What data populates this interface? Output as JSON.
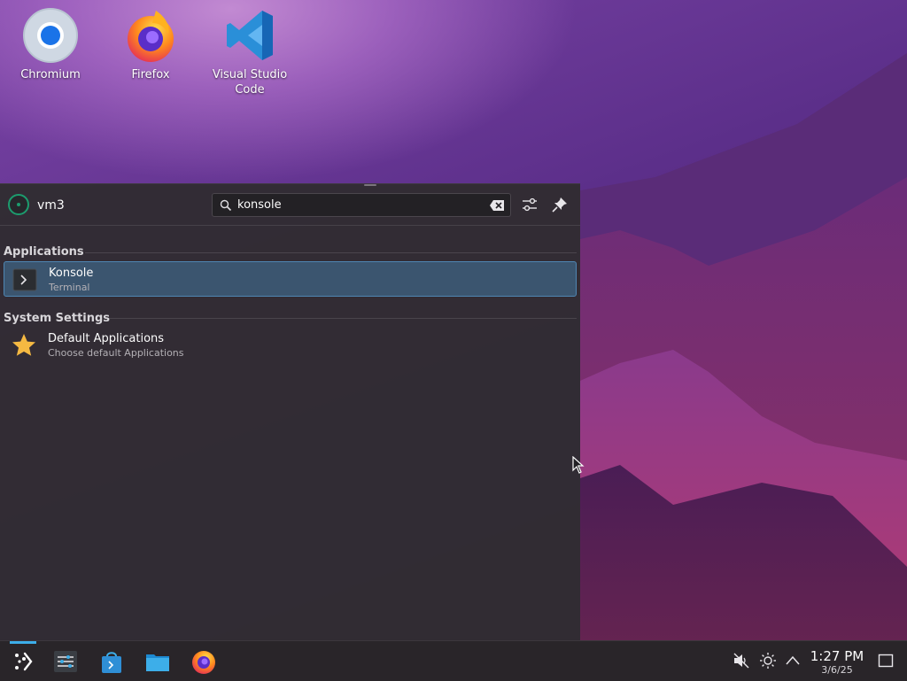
{
  "desktop": {
    "icons": [
      {
        "label": "Chromium"
      },
      {
        "label": "Firefox"
      },
      {
        "label": "Visual Studio Code"
      }
    ]
  },
  "launcher": {
    "username": "vm3",
    "search": {
      "value": "konsole"
    },
    "sections": [
      {
        "title": "Applications",
        "results": [
          {
            "title": "Konsole",
            "subtitle": "Terminal",
            "icon": "terminal-icon",
            "selected": true
          }
        ]
      },
      {
        "title": "System Settings",
        "results": [
          {
            "title": "Default Applications",
            "subtitle": "Choose default Applications",
            "icon": "star-icon",
            "selected": false
          }
        ]
      }
    ]
  },
  "taskbar": {
    "pinned": [
      "application-launcher-icon",
      "system-settings-icon",
      "discover-store-icon",
      "file-manager-icon",
      "firefox-icon"
    ],
    "tray": [
      "volume-muted-icon",
      "brightness-icon",
      "expand-tray-icon"
    ],
    "clock": {
      "time": "1:27 PM",
      "date": "3/6/25"
    }
  },
  "colors": {
    "accent": "#3daee9",
    "selection": "#3b556f",
    "panel": "#292529",
    "launcher_bg": "#312c32"
  }
}
